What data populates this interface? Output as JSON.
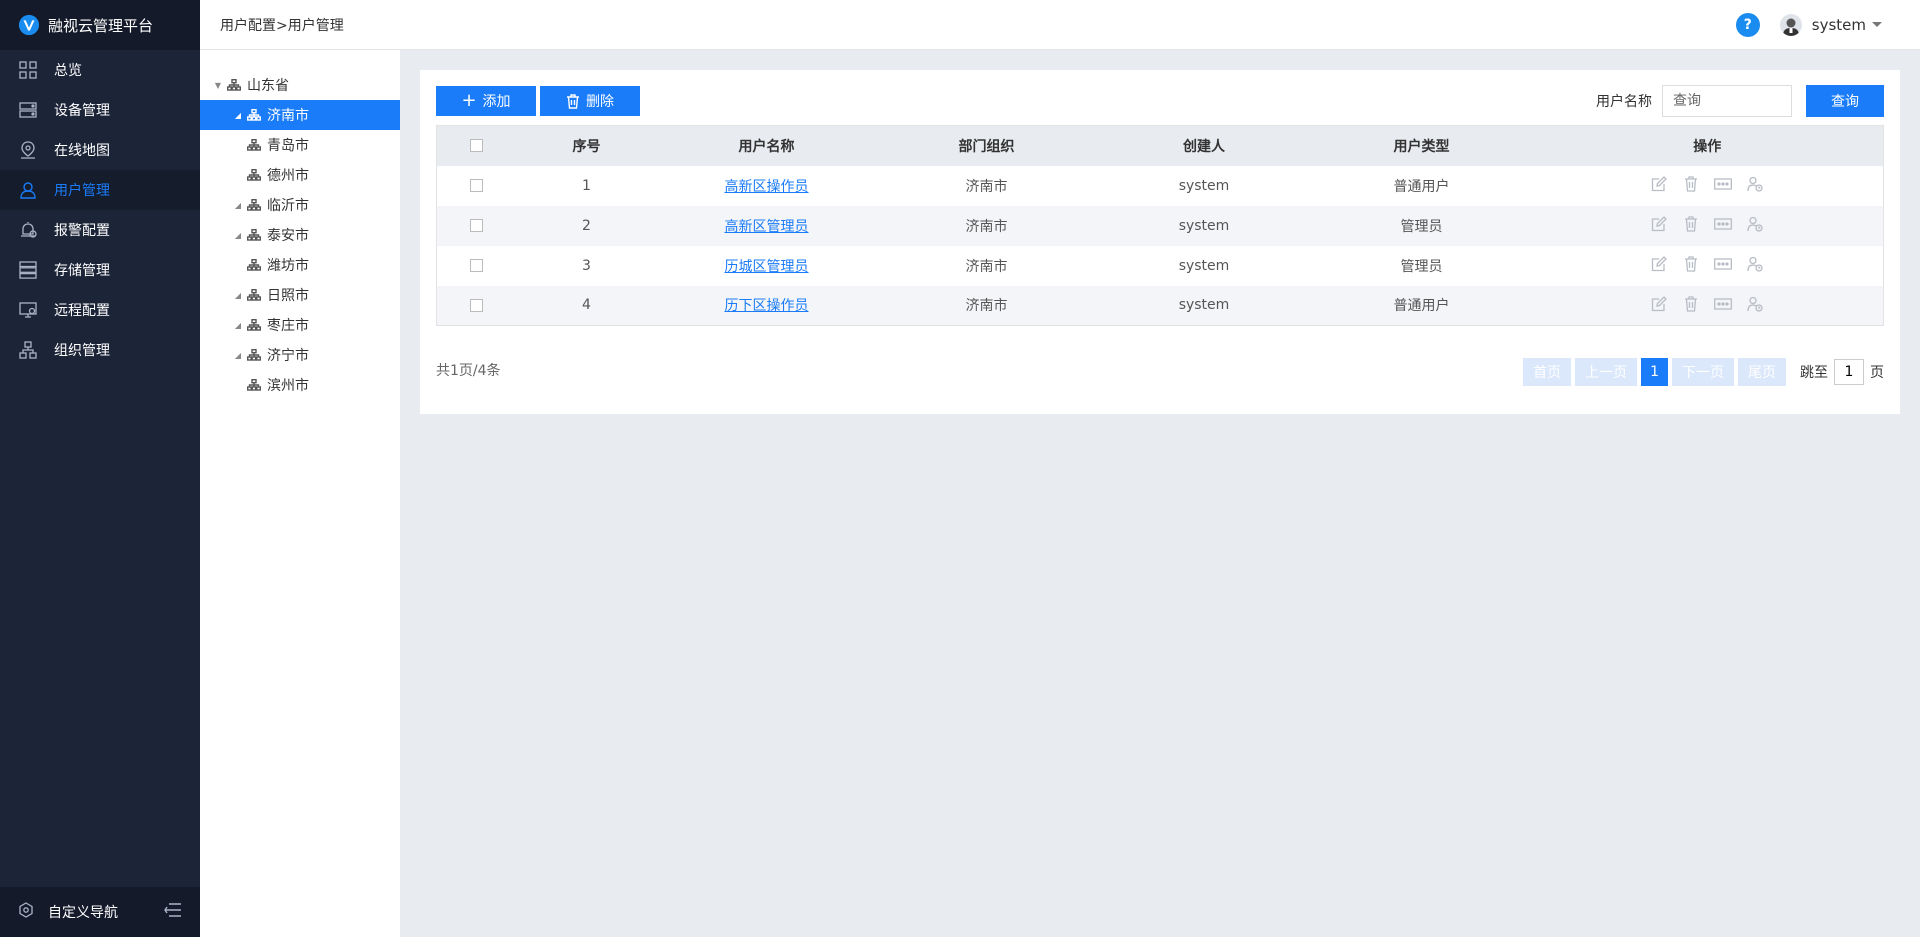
{
  "app": {
    "title": "融视云管理平台"
  },
  "sidebar": {
    "items": [
      {
        "label": "总览",
        "icon": "grid-icon",
        "active": false
      },
      {
        "label": "设备管理",
        "icon": "device-icon",
        "active": false
      },
      {
        "label": "在线地图",
        "icon": "map-pin-icon",
        "active": false
      },
      {
        "label": "用户管理",
        "icon": "user-icon",
        "active": true
      },
      {
        "label": "报警配置",
        "icon": "alarm-icon",
        "active": false
      },
      {
        "label": "存储管理",
        "icon": "storage-icon",
        "active": false
      },
      {
        "label": "远程配置",
        "icon": "remote-icon",
        "active": false
      },
      {
        "label": "组织管理",
        "icon": "org-icon",
        "active": false
      }
    ],
    "footer_label": "自定义导航"
  },
  "header": {
    "breadcrumb": "用户配置>用户管理",
    "help": "?",
    "username": "system"
  },
  "tree": {
    "nodes": [
      {
        "label": "山东省",
        "level": 0,
        "expanded": true,
        "selected": false,
        "has_children": true
      },
      {
        "label": "济南市",
        "level": 1,
        "selected": true,
        "has_children": true
      },
      {
        "label": "青岛市",
        "level": 1,
        "selected": false,
        "has_children": false
      },
      {
        "label": "德州市",
        "level": 1,
        "selected": false,
        "has_children": false
      },
      {
        "label": "临沂市",
        "level": 1,
        "selected": false,
        "has_children": true
      },
      {
        "label": "泰安市",
        "level": 1,
        "selected": false,
        "has_children": true
      },
      {
        "label": "潍坊市",
        "level": 1,
        "selected": false,
        "has_children": false
      },
      {
        "label": "日照市",
        "level": 1,
        "selected": false,
        "has_children": true
      },
      {
        "label": "枣庄市",
        "level": 1,
        "selected": false,
        "has_children": true
      },
      {
        "label": "济宁市",
        "level": 1,
        "selected": false,
        "has_children": true
      },
      {
        "label": "滨州市",
        "level": 1,
        "selected": false,
        "has_children": false
      }
    ]
  },
  "toolbar": {
    "add_label": "添加",
    "delete_label": "删除",
    "search_label": "用户名称",
    "search_placeholder": "查询",
    "query_label": "查询"
  },
  "table": {
    "columns": [
      "序号",
      "用户名称",
      "部门组织",
      "创建人",
      "用户类型",
      "操作"
    ],
    "rows": [
      {
        "index": "1",
        "name": "高新区操作员",
        "dept": "济南市",
        "creator": "system",
        "type": "普通用户"
      },
      {
        "index": "2",
        "name": "高新区管理员",
        "dept": "济南市",
        "creator": "system",
        "type": "管理员"
      },
      {
        "index": "3",
        "name": "历城区管理员",
        "dept": "济南市",
        "creator": "system",
        "type": "管理员"
      },
      {
        "index": "4",
        "name": "历下区操作员",
        "dept": "济南市",
        "creator": "system",
        "type": "普通用户"
      }
    ]
  },
  "pagination": {
    "total": "共1页/4条",
    "first": "首页",
    "prev": "上一页",
    "current": "1",
    "next": "下一页",
    "last": "尾页",
    "jump_label": "跳至",
    "jump_value": "1",
    "page_suffix": "页"
  },
  "colors": {
    "accent": "#1a7cf8",
    "sidebar_bg": "#1c2438",
    "header_bg": "#ffffff",
    "page_bg": "#e8ebef"
  }
}
